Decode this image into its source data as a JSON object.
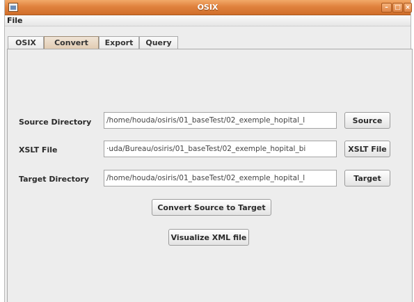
{
  "window": {
    "title": "OSIX"
  },
  "menubar": {
    "file": "File"
  },
  "tabs": [
    {
      "label": "OSIX"
    },
    {
      "label": "Convert"
    },
    {
      "label": "Export"
    },
    {
      "label": "Query"
    }
  ],
  "convert": {
    "source": {
      "label": "Source Directory",
      "value": "/home/houda/osiris/01_baseTest/02_exemple_hopital_l",
      "button": "Source"
    },
    "xslt": {
      "label": "XSLT File",
      "value": "·uda/Bureau/osiris/01_baseTest/02_exemple_hopital_bi",
      "button": "XSLT File"
    },
    "target": {
      "label": "Target Directory",
      "value": "/home/houda/osiris/01_baseTest/02_exemple_hopital_l",
      "button": "Target"
    },
    "convert_button": "Convert Source to Target",
    "visualize_button": "Visualize XML file"
  },
  "theme": {
    "titlebar": "#e0823e",
    "active_tab": "#e0c9ae"
  }
}
